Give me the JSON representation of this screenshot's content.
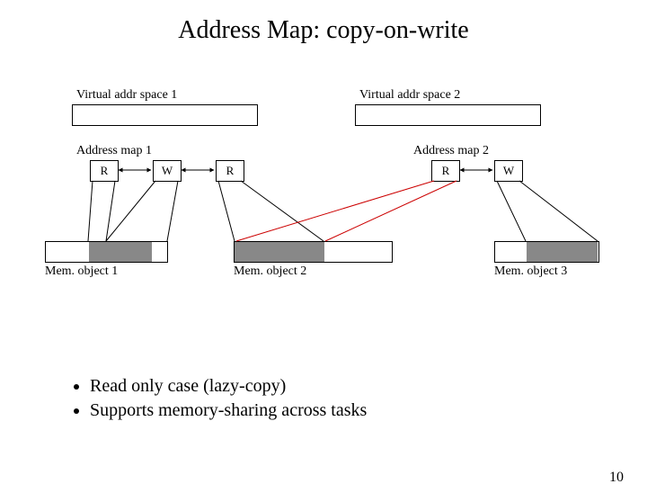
{
  "title": "Address Map: copy-on-write",
  "labels": {
    "vspace1": "Virtual addr space 1",
    "vspace2": "Virtual addr space 2",
    "map1": "Address map 1",
    "map2": "Address map 2",
    "mem1": "Mem. object 1",
    "mem2": "Mem. object 2",
    "mem3": "Mem. object 3"
  },
  "map_entries": {
    "m1a": "R",
    "m1b": "W",
    "m1c": "R",
    "m2a": "R",
    "m2b": "W"
  },
  "bullets": [
    "Read only case (lazy-copy)",
    "Supports memory-sharing across tasks"
  ],
  "page_number": "10"
}
